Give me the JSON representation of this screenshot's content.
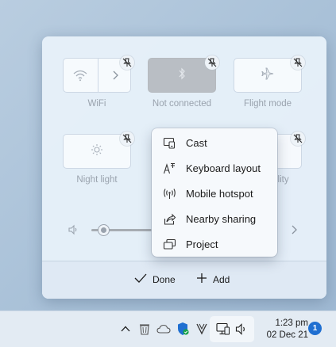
{
  "quick_settings": {
    "tiles": [
      {
        "label": "WiFi",
        "icon": "wifi-icon",
        "state": "off"
      },
      {
        "label": "Not connected",
        "icon": "bluetooth-icon",
        "state": "accent-off"
      },
      {
        "label": "Flight mode",
        "icon": "airplane-icon",
        "state": "off"
      },
      {
        "label": "Night light",
        "icon": "brightness-icon",
        "state": "off"
      },
      {
        "label": "ility",
        "icon": "accessibility-icon",
        "state": "off"
      }
    ],
    "volume": {
      "level": 0.15
    },
    "footer": {
      "done_label": "Done",
      "add_label": "Add"
    }
  },
  "context_menu": {
    "items": [
      {
        "label": "Cast",
        "icon": "cast-icon"
      },
      {
        "label": "Keyboard layout",
        "icon": "keyboard-layout-icon"
      },
      {
        "label": "Mobile hotspot",
        "icon": "mobile-hotspot-icon"
      },
      {
        "label": "Nearby sharing",
        "icon": "nearby-sharing-icon"
      },
      {
        "label": "Project",
        "icon": "project-icon"
      }
    ]
  },
  "taskbar": {
    "time": "1:23 pm",
    "date": "02 Dec 21",
    "notification_count": "1",
    "accent": "#1f6fd1"
  }
}
